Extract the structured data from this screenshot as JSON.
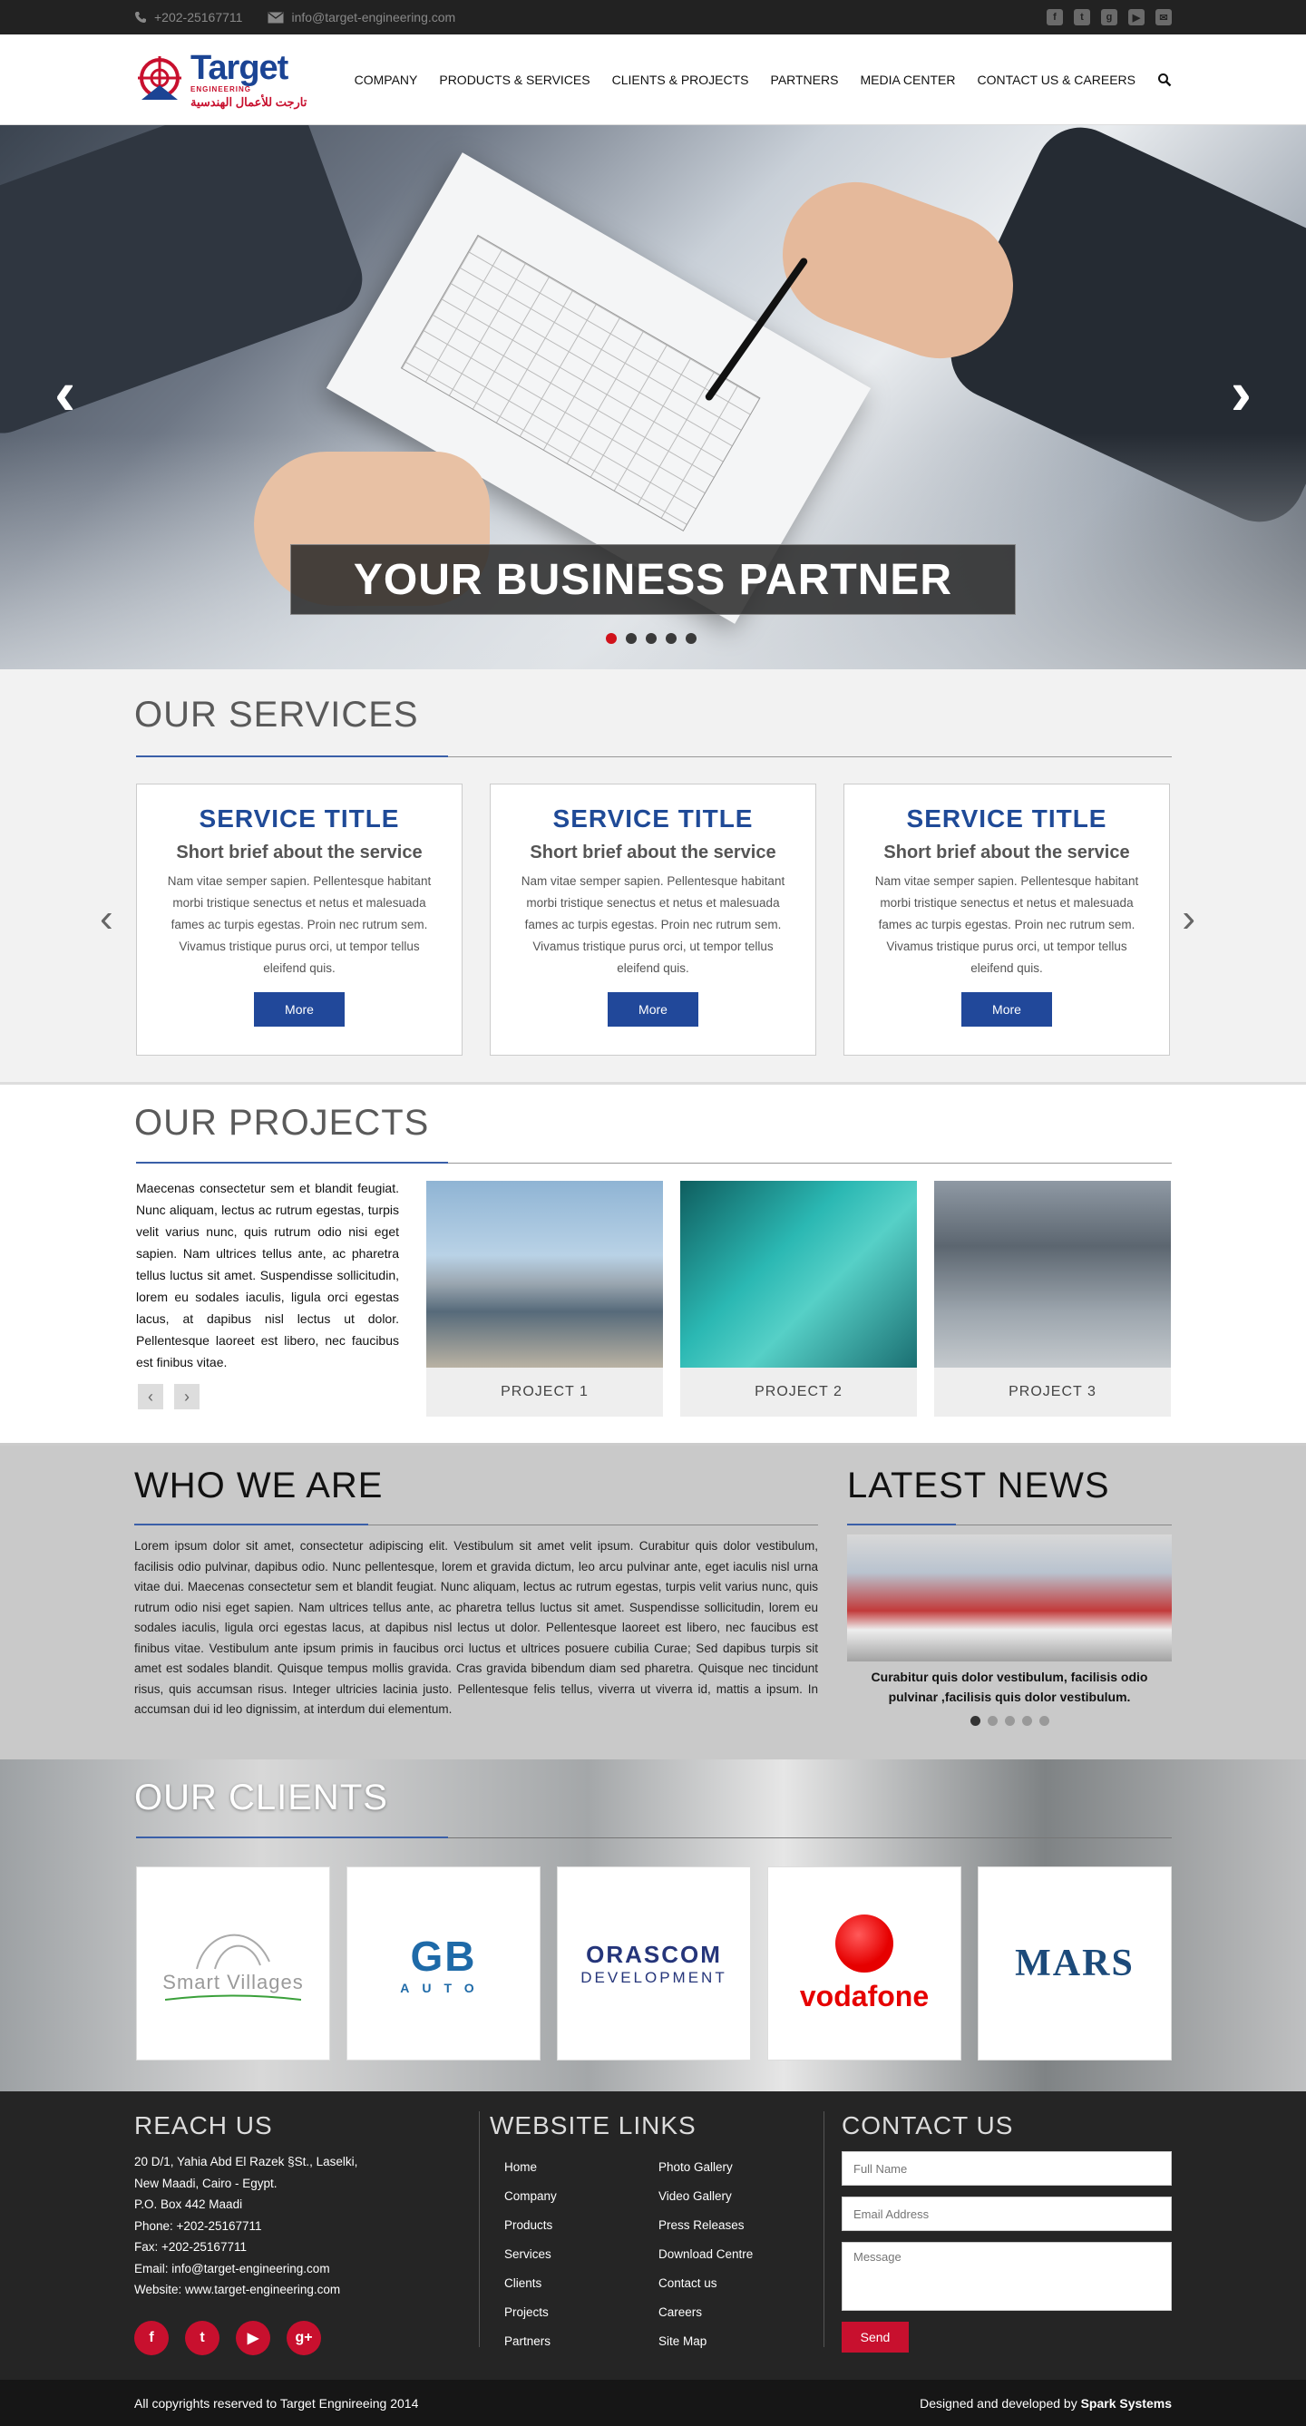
{
  "topbar": {
    "phone": "+202-25167711",
    "email": "info@target-engineering.com",
    "social": [
      "facebook-icon",
      "twitter-icon",
      "google-plus-icon",
      "youtube-icon",
      "mail-icon"
    ]
  },
  "header": {
    "logo_main": "Target",
    "logo_sub": "ENGINEERING",
    "logo_ar": "تارجت للأعمال الهندسية",
    "nav": [
      "COMPANY",
      "PRODUCTS & SERVICES",
      "CLIENTS & PROJECTS",
      "PARTNERS",
      "MEDIA CENTER",
      "CONTACT US & CAREERS"
    ]
  },
  "hero": {
    "caption": "YOUR BUSINESS PARTNER",
    "prev": "‹",
    "next": "›",
    "slides": 5,
    "active_slide": 1
  },
  "services": {
    "title": "OUR SERVICES",
    "items": [
      {
        "title": "SERVICE TITLE",
        "brief": "Short brief about the service",
        "text": "Nam vitae semper sapien. Pellentesque habitant morbi tristique senectus et netus et malesuada fames ac turpis egestas. Proin nec rutrum sem. Vivamus tristique purus orci, ut tempor tellus eleifend quis.",
        "button": "More"
      },
      {
        "title": "SERVICE TITLE",
        "brief": "Short brief about the service",
        "text": "Nam vitae semper sapien. Pellentesque habitant morbi tristique senectus et netus et malesuada fames ac turpis egestas. Proin nec rutrum sem. Vivamus tristique purus orci, ut tempor tellus eleifend quis.",
        "button": "More"
      },
      {
        "title": "SERVICE TITLE",
        "brief": "Short brief about the service",
        "text": "Nam vitae semper sapien. Pellentesque habitant morbi tristique senectus et netus et malesuada fames ac turpis egestas. Proin nec rutrum sem. Vivamus tristique purus orci, ut tempor tellus eleifend quis.",
        "button": "More"
      }
    ],
    "prev": "‹",
    "next": "›"
  },
  "projects": {
    "title": "OUR PROJECTS",
    "text": "Maecenas consectetur sem et blandit feugiat. Nunc aliquam, lectus ac rutrum egestas, turpis velit varius nunc, quis rutrum odio nisi eget sapien. Nam ultrices tellus ante, ac pharetra tellus luctus sit amet. Suspendisse sollicitudin, lorem eu sodales iaculis, ligula orci egestas lacus, at dapibus nisl lectus ut dolor. Pellentesque laoreet est libero, nec faucibus est finibus vitae.",
    "prev": "‹",
    "next": "›",
    "items": [
      "PROJECT 1",
      "PROJECT 2",
      "PROJECT 3"
    ]
  },
  "who": {
    "title": "WHO WE ARE",
    "text": "Lorem ipsum dolor sit amet, consectetur adipiscing elit. Vestibulum sit amet velit ipsum. Curabitur quis dolor vestibulum, facilisis odio pulvinar, dapibus odio. Nunc pellentesque, lorem et gravida dictum, leo arcu pulvinar ante, eget iaculis nisl urna vitae dui. Maecenas consectetur sem et blandit feugiat. Nunc aliquam, lectus ac rutrum egestas, turpis velit varius nunc, quis rutrum odio nisi eget sapien. Nam ultrices tellus ante, ac pharetra tellus luctus sit amet. Suspendisse sollicitudin, lorem eu sodales iaculis, ligula orci egestas lacus, at dapibus nisl lectus ut dolor. Pellentesque laoreet est libero, nec faucibus est finibus vitae. Vestibulum ante ipsum primis in faucibus orci luctus et ultrices posuere cubilia Curae; Sed dapibus turpis sit amet est sodales blandit. Quisque tempus mollis gravida. Cras gravida bibendum diam sed pharetra. Quisque nec tincidunt risus, quis accumsan risus. Integer ultricies lacinia justo. Pellentesque felis tellus, viverra ut viverra id, mattis a ipsum. In accumsan dui id leo dignissim, at interdum dui elementum."
  },
  "news": {
    "title": "LATEST NEWS",
    "caption": "Curabitur quis dolor vestibulum, facilisis odio pulvinar ,facilisis quis dolor vestibulum.",
    "slides": 5,
    "active_slide": 1
  },
  "clients": {
    "title": "OUR CLIENTS",
    "items": [
      {
        "name": "Smart Villages"
      },
      {
        "name": "GB",
        "sub": "AUTO"
      },
      {
        "name": "ORASCOM",
        "sub": "DEVELOPMENT"
      },
      {
        "name": "vodafone"
      },
      {
        "name": "MARS"
      }
    ]
  },
  "footer": {
    "reach": {
      "title": "REACH US",
      "lines": [
        "20 D/1, Yahia Abd El Razek §St., Laselki,",
        "New Maadi, Cairo - Egypt.",
        "P.O. Box 442 Maadi",
        "Phone: +202-25167711",
        "Fax: +202-25167711",
        "Email: info@target-engineering.com",
        "Website: www.target-engineering.com"
      ],
      "social": [
        "f",
        "t",
        "▶",
        "g+"
      ]
    },
    "links": {
      "title": "WEBSITE LINKS",
      "col1": [
        "Home",
        "Company",
        "Products",
        "Services",
        "Clients",
        "Projects",
        "Partners"
      ],
      "col2": [
        "Photo Gallery",
        "Video Gallery",
        "Press Releases",
        "Download Centre",
        "Contact us",
        "Careers",
        "Site Map"
      ]
    },
    "contact": {
      "title": "CONTACT US",
      "name_placeholder": "Full Name",
      "email_placeholder": "Email Address",
      "message_placeholder": "Message",
      "send": "Send"
    }
  },
  "copyright": {
    "left": "All copyrights reserved to Target Engnireeing 2014",
    "right_prefix": "Designed and developed by ",
    "right_brand": "Spark Systems"
  }
}
